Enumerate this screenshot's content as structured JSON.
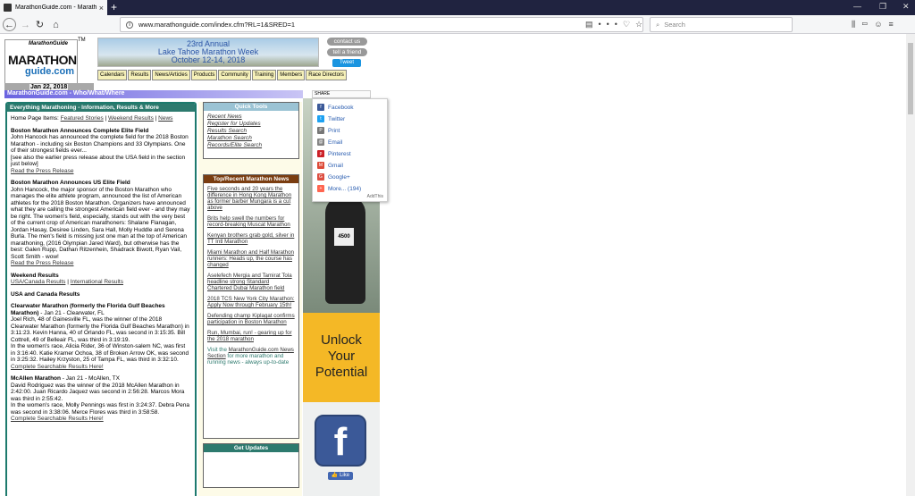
{
  "browser": {
    "tab_title": "MarathonGuide.com - Maratho",
    "tab_close": "×",
    "new_tab": "+",
    "url": "www.marathonguide.com/index.cfm?RL=1&SRED=1",
    "search_placeholder": "Search"
  },
  "header": {
    "logo_top": "MarathonGuide",
    "logo_main": "MARATHON",
    "logo_sub": "guide.com",
    "tm": "TM",
    "date": "Jan 22, 2018",
    "banner": {
      "line1": "23rd Annual",
      "line2": "Lake Tahoe Marathon Week",
      "line3": "October 12-14, 2018"
    },
    "contact_label": "contact us",
    "tell_label": "tell a friend",
    "tweet_label": "Tweet",
    "menu": [
      "Calendars",
      "Results",
      "News/Articles",
      "Products",
      "Community",
      "Training",
      "Members",
      "Race Directors"
    ]
  },
  "section_title": "MarathonGuide.com - Who/What/Where",
  "share_bar_label": "SHARE",
  "left": {
    "header": "Everything Marathoning - Information, Results & More",
    "home_items_label": "Home Page Items:",
    "home_links": [
      "Featured Stories",
      "Weekend Results",
      "News"
    ],
    "stories": [
      {
        "title": "Boston Marathon Announces Complete Elite Field",
        "text": "John Hancock has announced the complete field for the 2018 Boston Marathon - including six Boston Champions and 33 Olympians. One of their strongest fields ever...",
        "extra": "[see also the earlier press release about the USA field in the section just below]",
        "link": "Read the Press Release"
      },
      {
        "title": "Boston Marathon Announces US Elite Field",
        "text": "John Hancock, the major sponsor of the Boston Marathon who manages the elite athlete program, announced the list of American athletes for the 2018 Boston Marathon. Organizers have announced what they are calling the strongest American field ever - and they may be right. The women's field, especially, stands out with the very best of the current crop of American marathoners: Shalane Flanagan, Jordan Hasay, Desiree Linden, Sara Hall, Molly Huddle and Serena Burla. The men's field is missing just one man at the top of American marathoning, (2016 Olympian Jared Ward), but otherwise has the best: Galen Rupp, Dathan Ritzenhein, Shadrack Biwott, Ryan Vail, Scott Smith - wow!",
        "extra": "",
        "link": "Read the Press Release"
      }
    ],
    "weekend_title": "Weekend Results",
    "weekend_links": [
      "USA/Canada Results",
      "International Results"
    ],
    "usa_title": "USA and Canada Results",
    "races": [
      {
        "title": "Clearwater Marathon (formerly the Florida Gulf Beaches Marathon)",
        "date": " - Jan 21 - Clearwater, FL",
        "text1": "Joel Rich, 48 of Gainesville FL, was the winner of the 2018 Clearwater Marathon (formerly the Florida Gulf Beaches Marathon) in 3:11:23. Kevin Hanna, 40 of Orlando FL, was second in 3:15:35. Bill Cottrell, 49 of Belleair FL, was third in 3:19:19.",
        "text2": "In the women's race, Alicia Rider, 36 of Winston-salem NC, was first in 3:16:40. Katie Kramer Ochoa, 38 of Broken Arrow OK, was second in 3:25:32. Hailey Krzyston, 25 of Tampa FL, was third in 3:32:10.",
        "link": "Complete Searchable Results Here!"
      },
      {
        "title": "McAllen Marathon",
        "date": " - Jan 21 - McAllen, TX",
        "text1": "David Rodriguez was the winner of the 2018 McAllen Marathon in 2:42:00. Juan Ricardo Jaquez was second in 2:56:28. Marcos Mora was third in 2:55:42.",
        "text2": "In the women's race, Molly Pennings was first in 3:24:37. Debra Pena was second in 3:38:06. Merce Flores was third in 3:58:58.",
        "link": "Complete Searchable Results Here!"
      }
    ]
  },
  "quick_tools": {
    "title": "Quick Tools",
    "links": [
      "Recent News",
      "Register for Updates",
      "Results Search",
      "Marathon Search",
      "Records/Elite Search"
    ]
  },
  "news": {
    "title": "Top/Recent Marathon News",
    "items": [
      "Five seconds and 20 years the difference in Hong Kong Marathon as former barber Mungara is a cut above",
      "Brits help swell the numbers for record-breaking Muscat Marathon",
      "Kenyan brothers grab gold, silver in TT Intl Marathon",
      "Miami Marathon and Half Marathon runners: Heads up, the course has changed",
      "Aselefech Mergia and Tamirat Tola headline strong Standard Chartered Dubai Marathon field",
      "2018 TCS New York City Marathon: Apply Now through February 15th!",
      "Defending champ Kiplagat confirms participation in Boston Marathon",
      "Run, Mumbai, run! - gearing up for the 2018 marathon"
    ],
    "visit_pre": "Visit the ",
    "visit_link": "MarathonGuide.com News Section",
    "visit_post": " for more marathon and running news - always up-to-date"
  },
  "get_updates_title": "Get Updates",
  "ads": {
    "bib": "4500",
    "unlock": [
      "Unlock",
      "Your",
      "Potential"
    ],
    "fb_letter": "f",
    "like_label": "Like"
  },
  "share_popup": {
    "items": [
      {
        "label": "Facebook",
        "color": "#3b5998",
        "glyph": "f"
      },
      {
        "label": "Twitter",
        "color": "#1da1f2",
        "glyph": "t"
      },
      {
        "label": "Print",
        "color": "#777777",
        "glyph": "P"
      },
      {
        "label": "Email",
        "color": "#848484",
        "glyph": "@"
      },
      {
        "label": "Pinterest",
        "color": "#cb2027",
        "glyph": "p"
      },
      {
        "label": "Gmail",
        "color": "#dd4b39",
        "glyph": "M"
      },
      {
        "label": "Google+",
        "color": "#dc4e41",
        "glyph": "G"
      },
      {
        "label": "More... (194)",
        "color": "#ff6550",
        "glyph": "+"
      }
    ],
    "attribution": "AddThis"
  }
}
